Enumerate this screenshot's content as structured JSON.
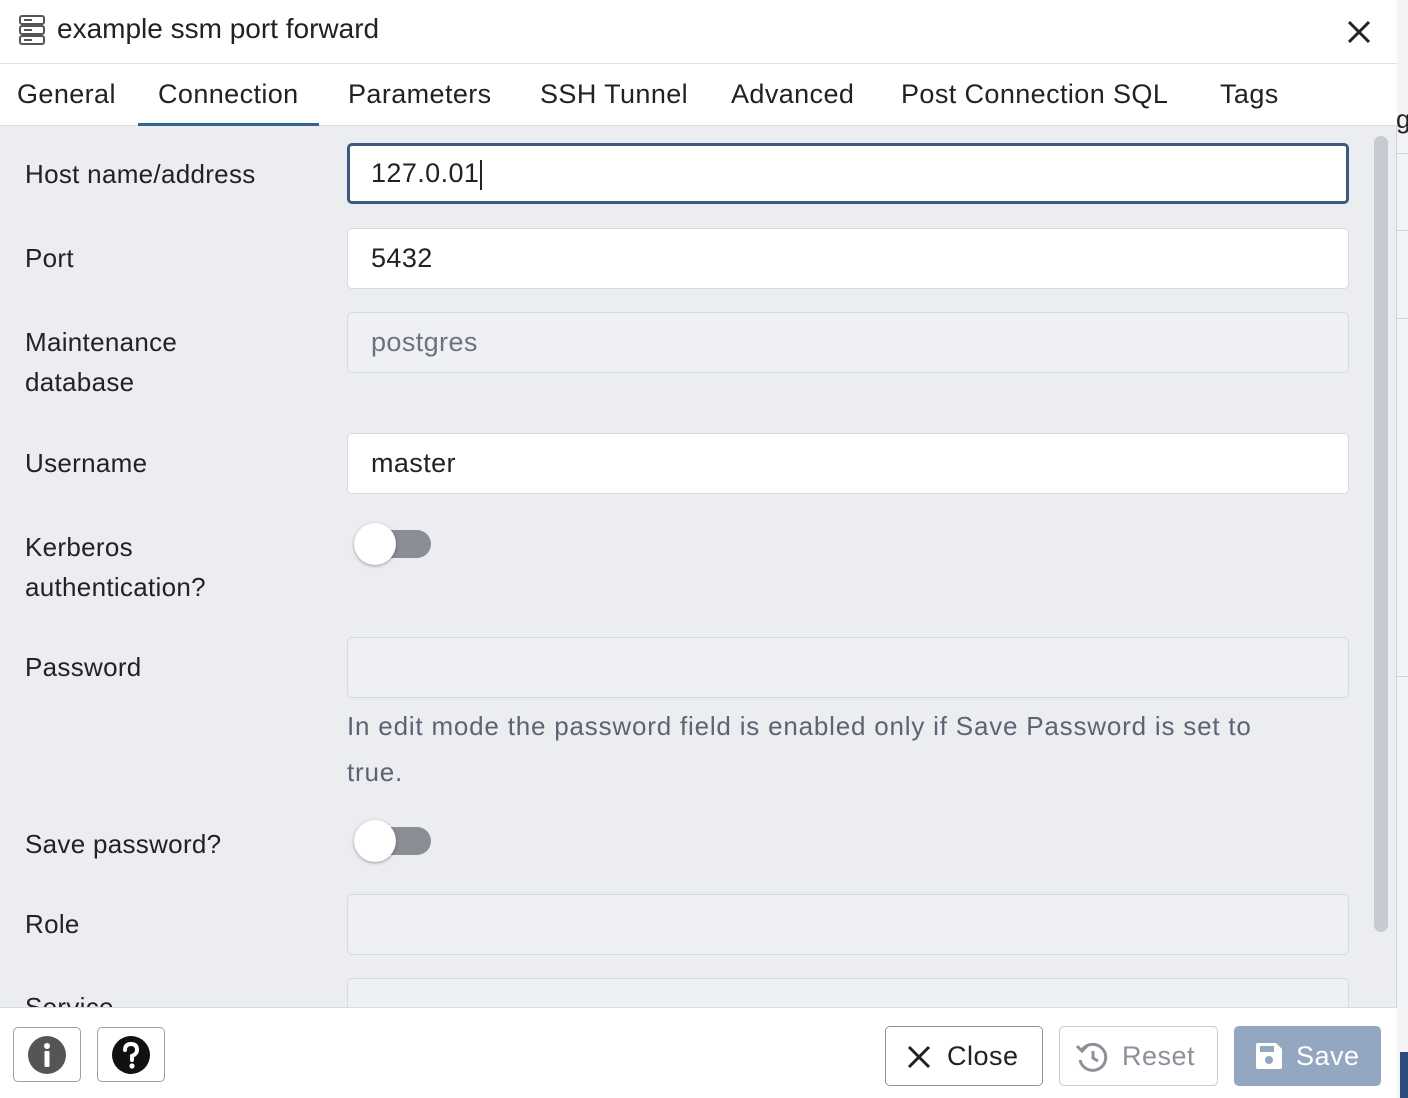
{
  "dialog": {
    "title": "example ssm port forward"
  },
  "tabs": [
    {
      "label": "General"
    },
    {
      "label": "Connection"
    },
    {
      "label": "Parameters"
    },
    {
      "label": "SSH Tunnel"
    },
    {
      "label": "Advanced"
    },
    {
      "label": "Post Connection SQL"
    },
    {
      "label": "Tags"
    }
  ],
  "active_tab": "Connection",
  "form": {
    "host": {
      "label": "Host name/address",
      "value": "127.0.01"
    },
    "port": {
      "label": "Port",
      "value": "5432"
    },
    "maintenance_db": {
      "label_line1": "Maintenance",
      "label_line2": "database",
      "value": "postgres"
    },
    "username": {
      "label": "Username",
      "value": "master"
    },
    "kerberos": {
      "label_line1": "Kerberos",
      "label_line2": "authentication?",
      "enabled": false
    },
    "password": {
      "label": "Password",
      "value": "",
      "help": "In edit mode the password field is enabled only if Save Password is set to",
      "help_line2": "true."
    },
    "save_password": {
      "label": "Save password?",
      "enabled": false
    },
    "role": {
      "label": "Role",
      "value": ""
    },
    "service": {
      "label": "Service",
      "value": ""
    }
  },
  "footer": {
    "close_label": "Close",
    "reset_label": "Reset",
    "save_label": "Save"
  },
  "colors": {
    "accent": "#326690",
    "save_button": "#93a7c0",
    "focus_border": "#3b5a82"
  }
}
